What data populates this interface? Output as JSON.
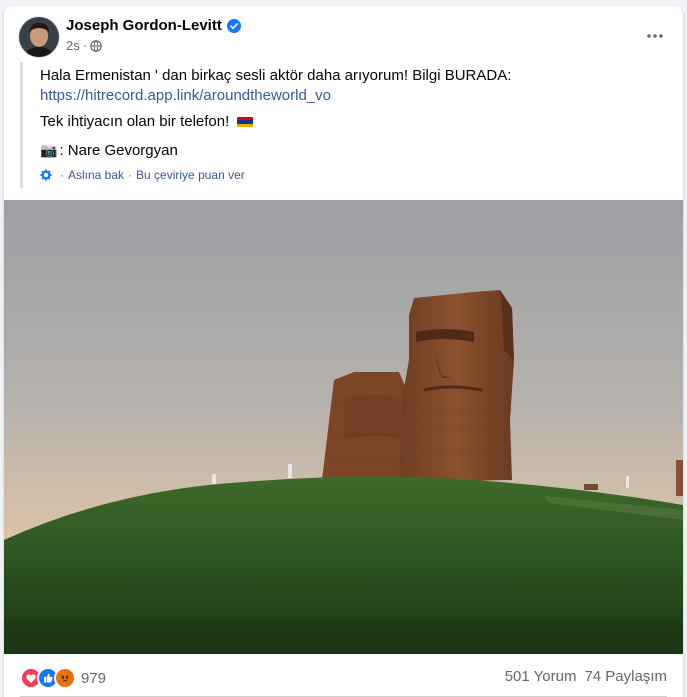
{
  "post": {
    "author": "Joseph Gordon-Levitt",
    "time": "2s",
    "lines": {
      "line1": "Hala Ermenistan ' dan birkaç sesli aktör daha arıyorum! Bilgi BURADA:",
      "link": "https://hitrecord.app.link/aroundtheworld_vo",
      "line2": "Tek ihtiyacın olan bir telefon!",
      "line3": ": Nare Gevorgyan"
    },
    "translate": {
      "see_original": "Aslına bak",
      "separator": "·",
      "rate": "Bu çeviriye puan ver"
    },
    "icons": [
      "verified-badge-icon",
      "globe-icon",
      "more-options-icon",
      "camera-emoji",
      "armenia-flag-emoji",
      "gear-icon"
    ]
  },
  "footer": {
    "reaction_count": "979",
    "comments": "501 Yorum",
    "shares": "74 Paylaşım",
    "reaction_icons": [
      "love",
      "like",
      "angry"
    ]
  },
  "colors": {
    "link": "#385898",
    "secondary_text": "#65676b",
    "verified": "#1877f2"
  }
}
